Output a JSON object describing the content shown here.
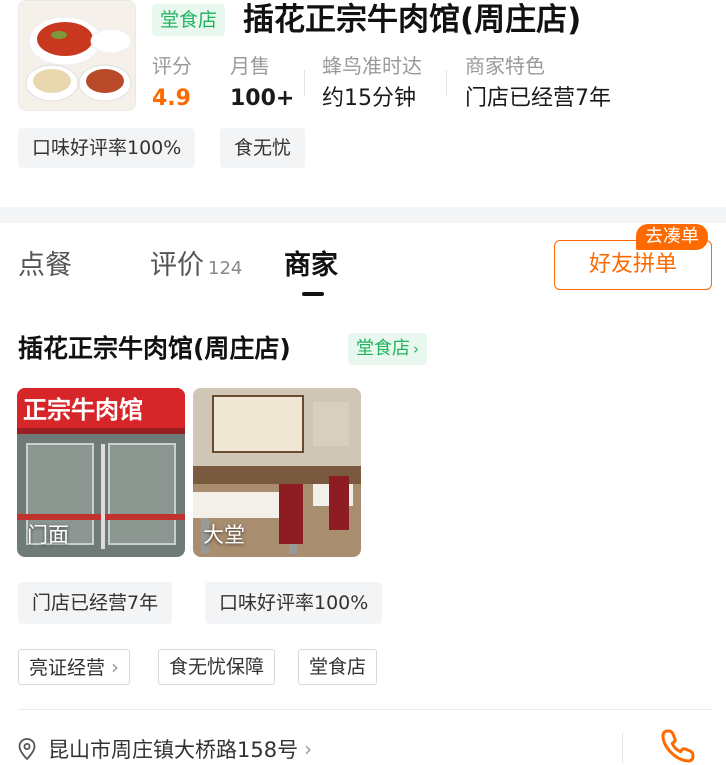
{
  "header": {
    "tag": "堂食店",
    "title": "插花正宗牛肉馆(周庄店)",
    "stats": [
      {
        "label": "评分",
        "value": "4.9"
      },
      {
        "label": "月售",
        "value": "100+"
      },
      {
        "label": "蜂鸟准时达",
        "value": "约15分钟"
      },
      {
        "label": "商家特色",
        "value": "门店已经营7年"
      }
    ],
    "chips": [
      "口味好评率100%",
      "食无忧"
    ]
  },
  "tabs": {
    "order": "点餐",
    "reviews": "评价",
    "reviews_count": "124",
    "merchant": "商家"
  },
  "group_order": {
    "label": "好友拼单",
    "badge": "去凑单"
  },
  "merchant": {
    "name": "插花正宗牛肉馆(周庄店)",
    "tag": "堂食店",
    "photos": [
      {
        "label": "门面",
        "sign_text": "正宗牛肉馆"
      },
      {
        "label": "大堂"
      }
    ],
    "chips": [
      "门店已经营7年",
      "口味好评率100%"
    ],
    "tags": [
      "亮证经营",
      "食无忧保障",
      "堂食店"
    ],
    "address": "昆山市周庄镇大桥路158号"
  },
  "colors": {
    "accent": "#ff6a00",
    "green": "#22b35e",
    "green_bg": "#e9f8ee"
  },
  "icons": {
    "location": "location-pin-icon",
    "phone": "phone-icon",
    "chevron": "chevron-right-icon"
  }
}
